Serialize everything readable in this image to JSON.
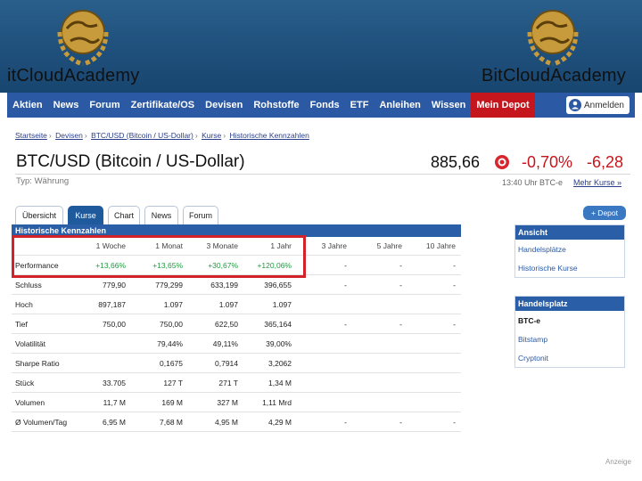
{
  "branding": {
    "name": "BitCloudAcademy",
    "name_left_visible": "itCloudAcademy"
  },
  "nav": {
    "items": [
      "Aktien",
      "News",
      "Forum",
      "Zertifikate/OS",
      "Devisen",
      "Rohstoffe",
      "Fonds",
      "ETF",
      "Anleihen",
      "Wissen"
    ],
    "depot": "Mein Depot",
    "login": "Anmelden"
  },
  "breadcrumb": [
    "Startseite",
    "Devisen",
    "BTC/USD (Bitcoin / US-Dollar)",
    "Kurse",
    "Historische Kennzahlen"
  ],
  "instrument": {
    "title": "BTC/USD (Bitcoin / US-Dollar)",
    "type": "Typ: Währung",
    "price": "885,66",
    "change_pct": "-0,70%",
    "change_abs": "-6,28",
    "time_info": "13:40 Uhr BTC-e",
    "more_link": "Mehr Kurse »"
  },
  "tabs": [
    "Übersicht",
    "Kurse",
    "Chart",
    "News",
    "Forum"
  ],
  "active_tab": "Kurse",
  "depot_button": "+ Depot",
  "table": {
    "title": "Historische Kennzahlen",
    "columns": [
      "1 Woche",
      "1 Monat",
      "3 Monate",
      "1 Jahr",
      "3 Jahre",
      "5 Jahre",
      "10 Jahre"
    ],
    "rows": [
      {
        "label": "Performance",
        "values": [
          "+13,66%",
          "+13,65%",
          "+30,67%",
          "+120,06%",
          "-",
          "-",
          "-"
        ]
      },
      {
        "label": "Schluss",
        "values": [
          "779,90",
          "779,299",
          "633,199",
          "396,655",
          "-",
          "-",
          "-"
        ]
      },
      {
        "label": "Hoch",
        "values": [
          "897,187",
          "1.097",
          "1.097",
          "1.097",
          "",
          "",
          ""
        ]
      },
      {
        "label": "Tief",
        "values": [
          "750,00",
          "750,00",
          "622,50",
          "365,164",
          "-",
          "-",
          "-"
        ]
      },
      {
        "label": "Volatilität",
        "values": [
          "",
          "79,44%",
          "49,11%",
          "39,00%",
          "",
          "",
          ""
        ]
      },
      {
        "label": "Sharpe Ratio",
        "values": [
          "",
          "0,1675",
          "0,7914",
          "3,2062",
          "",
          "",
          ""
        ]
      },
      {
        "label": "Stück",
        "values": [
          "33.705",
          "127 T",
          "271 T",
          "1,34 M",
          "",
          "",
          ""
        ]
      },
      {
        "label": "Volumen",
        "values": [
          "11,7 M",
          "169 M",
          "327 M",
          "1,11 Mrd",
          "",
          "",
          ""
        ]
      },
      {
        "label": "Ø Volumen/Tag",
        "values": [
          "6,95 M",
          "7,68 M",
          "4,95 M",
          "4,29 M",
          "-",
          "-",
          "-"
        ]
      }
    ]
  },
  "sidebar": {
    "view": {
      "title": "Ansicht",
      "links": [
        "Handelsplätze",
        "Historische Kurse"
      ]
    },
    "venue": {
      "title": "Handelsplatz",
      "current": "BTC-e",
      "links": [
        "Bitstamp",
        "Cryptonit"
      ]
    }
  },
  "ad_label": "Anzeige",
  "colors": {
    "nav": "#2b59a3",
    "depot": "#c4161c",
    "positive": "#1e9a3e",
    "negative": "#c4161c",
    "highlight": "#d2232a"
  }
}
